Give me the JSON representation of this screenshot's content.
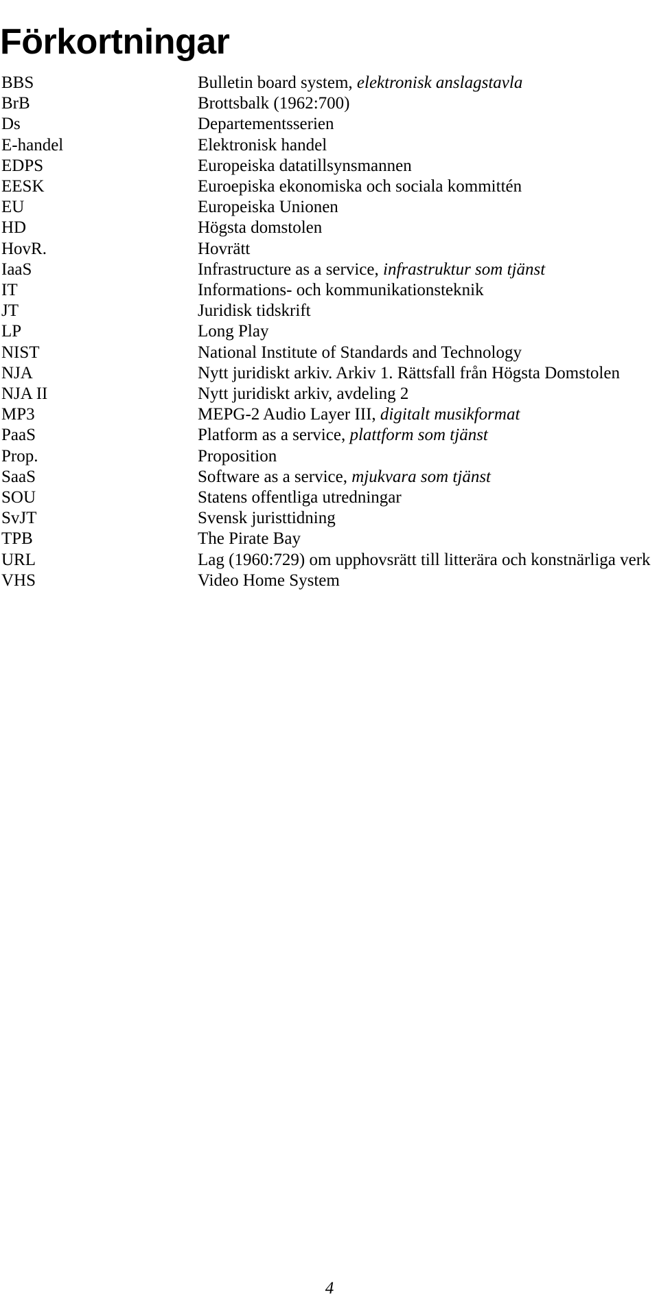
{
  "document": {
    "title": "Förkortningar",
    "page_number": "4"
  },
  "abbreviations": [
    {
      "term": "BBS",
      "def_plain": "Bulletin board system, ",
      "def_italic": "elektronisk anslagstavla",
      "def_tail": ""
    },
    {
      "term": "BrB",
      "def_plain": "Brottsbalk (1962:700)",
      "def_italic": "",
      "def_tail": ""
    },
    {
      "term": "Ds",
      "def_plain": "Departementsserien",
      "def_italic": "",
      "def_tail": ""
    },
    {
      "term": "E-handel",
      "def_plain": "Elektronisk handel",
      "def_italic": "",
      "def_tail": ""
    },
    {
      "term": "EDPS",
      "def_plain": "Europeiska datatillsynsmannen",
      "def_italic": "",
      "def_tail": ""
    },
    {
      "term": "EESK",
      "def_plain": "Euroepiska ekonomiska och sociala kommittén",
      "def_italic": "",
      "def_tail": ""
    },
    {
      "term": "EU",
      "def_plain": "Europeiska Unionen",
      "def_italic": "",
      "def_tail": ""
    },
    {
      "term": "HD",
      "def_plain": "Högsta domstolen",
      "def_italic": "",
      "def_tail": ""
    },
    {
      "term": "HovR.",
      "def_plain": "Hovrätt",
      "def_italic": "",
      "def_tail": ""
    },
    {
      "term": "IaaS",
      "def_plain": "Infrastructure as a service, ",
      "def_italic": "infrastruktur som tjänst",
      "def_tail": ""
    },
    {
      "term": "IT",
      "def_plain": "Informations- och kommunikationsteknik",
      "def_italic": "",
      "def_tail": ""
    },
    {
      "term": "JT",
      "def_plain": "Juridisk tidskrift",
      "def_italic": "",
      "def_tail": ""
    },
    {
      "term": "LP",
      "def_plain": "Long Play",
      "def_italic": "",
      "def_tail": ""
    },
    {
      "term": "NIST",
      "def_plain": "National Institute of Standards and Technology",
      "def_italic": "",
      "def_tail": ""
    },
    {
      "term": "NJA",
      "def_plain": "Nytt juridiskt arkiv. Arkiv 1. Rättsfall från Högsta Domstolen",
      "def_italic": "",
      "def_tail": ""
    },
    {
      "term": "NJA II",
      "def_plain": "Nytt juridiskt arkiv, avdeling 2",
      "def_italic": "",
      "def_tail": ""
    },
    {
      "term": "MP3",
      "def_plain": "MEPG-2 Audio Layer III, ",
      "def_italic": "digitalt musikformat",
      "def_tail": ""
    },
    {
      "term": "PaaS",
      "def_plain": "Platform as a service, ",
      "def_italic": "plattform som tjänst",
      "def_tail": ""
    },
    {
      "term": "Prop.",
      "def_plain": "Proposition",
      "def_italic": "",
      "def_tail": ""
    },
    {
      "term": "SaaS",
      "def_plain": "Software as a service, ",
      "def_italic": "mjukvara som tjänst",
      "def_tail": ""
    },
    {
      "term": "SOU",
      "def_plain": "Statens offentliga utredningar",
      "def_italic": "",
      "def_tail": ""
    },
    {
      "term": "SvJT",
      "def_plain": "Svensk juristtidning",
      "def_italic": "",
      "def_tail": ""
    },
    {
      "term": "TPB",
      "def_plain": "The Pirate Bay",
      "def_italic": "",
      "def_tail": ""
    },
    {
      "term": "URL",
      "def_plain": "Lag (1960:729) om upphovsrätt till litterära och konstnärliga verk",
      "def_italic": "",
      "def_tail": ""
    },
    {
      "term": "VHS",
      "def_plain": "Video Home System",
      "def_italic": "",
      "def_tail": ""
    }
  ]
}
